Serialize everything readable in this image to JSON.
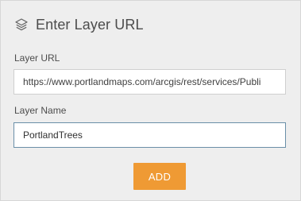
{
  "dialog": {
    "title": "Enter Layer URL",
    "title_icon": "layers-icon"
  },
  "form": {
    "layer_url": {
      "label": "Layer URL",
      "value": "https://www.portlandmaps.com/arcgis/rest/services/Publi"
    },
    "layer_name": {
      "label": "Layer Name",
      "value": "PortlandTrees"
    },
    "add_label": "ADD"
  },
  "colors": {
    "accent": "#ef9a34",
    "focus_border": "#6a8fa8",
    "background": "#eeeeee"
  }
}
